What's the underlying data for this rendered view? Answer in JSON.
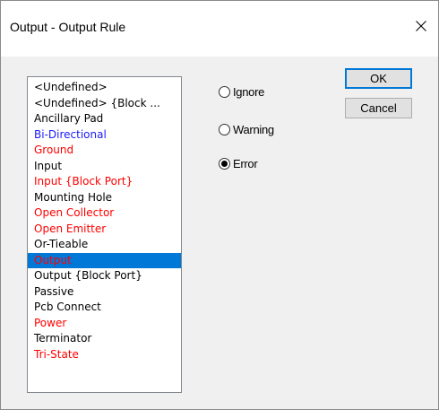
{
  "dialog": {
    "title": "Output - Output Rule",
    "close_icon": "close-icon"
  },
  "pin_types": {
    "items": [
      {
        "label": "<Undefined>",
        "color": "#000000",
        "selected": false
      },
      {
        "label": "<Undefined> {Block ...",
        "color": "#000000",
        "selected": false
      },
      {
        "label": "Ancillary Pad",
        "color": "#000000",
        "selected": false
      },
      {
        "label": "Bi-Directional",
        "color": "#1a1aff",
        "selected": false
      },
      {
        "label": "Ground",
        "color": "#ff0000",
        "selected": false
      },
      {
        "label": "Input",
        "color": "#000000",
        "selected": false
      },
      {
        "label": "Input {Block Port}",
        "color": "#ff0000",
        "selected": false
      },
      {
        "label": "Mounting Hole",
        "color": "#000000",
        "selected": false
      },
      {
        "label": "Open Collector",
        "color": "#ff0000",
        "selected": false
      },
      {
        "label": "Open Emitter",
        "color": "#ff0000",
        "selected": false
      },
      {
        "label": "Or-Tieable",
        "color": "#000000",
        "selected": false
      },
      {
        "label": "Output",
        "color": "#ff0000",
        "selected": true
      },
      {
        "label": "Output {Block Port}",
        "color": "#000000",
        "selected": false
      },
      {
        "label": "Passive",
        "color": "#000000",
        "selected": false
      },
      {
        "label": "Pcb Connect",
        "color": "#000000",
        "selected": false
      },
      {
        "label": "Power",
        "color": "#ff0000",
        "selected": false
      },
      {
        "label": "Terminator",
        "color": "#000000",
        "selected": false
      },
      {
        "label": "Tri-State",
        "color": "#ff0000",
        "selected": false
      }
    ]
  },
  "severity": {
    "ignore_label": "Ignore",
    "warning_label": "Warning",
    "error_label": "Error",
    "selected": "Error"
  },
  "buttons": {
    "ok_label": "OK",
    "cancel_label": "Cancel"
  },
  "colors": {
    "selection": "#0078d7",
    "default_button_border": "#0078d7"
  }
}
